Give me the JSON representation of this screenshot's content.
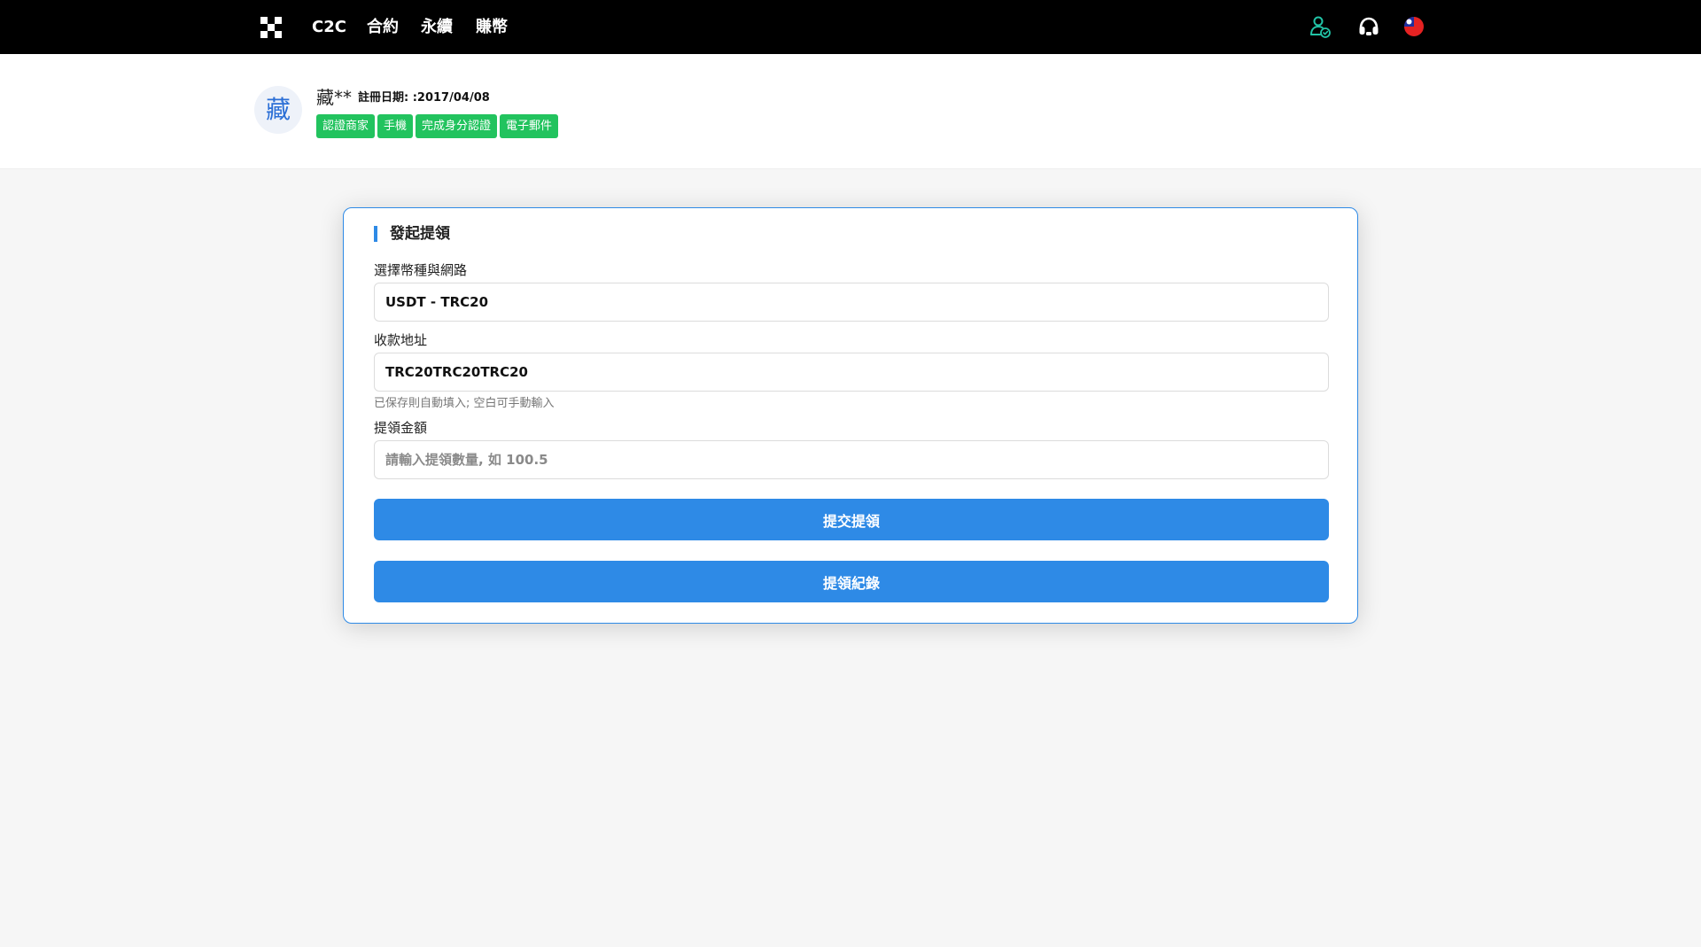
{
  "nav": {
    "items": [
      {
        "label": "C2C"
      },
      {
        "label": "合約"
      },
      {
        "label": "永續"
      },
      {
        "label": "賺幣"
      }
    ],
    "icons": [
      "user-shield-icon",
      "headset-icon",
      "flag-icon"
    ]
  },
  "profile": {
    "avatar_char": "藏",
    "name": "藏**",
    "registration": "註冊日期: :2017/04/08",
    "badges": [
      "認證商家",
      "手機",
      "完成身分認證",
      "電子郵件"
    ]
  },
  "withdraw": {
    "title": "發起提領",
    "coin_label": "選擇幣種與網路",
    "coin_value": "USDT - TRC20",
    "address_label": "收款地址",
    "address_value": "TRC20TRC20TRC20",
    "address_hint": "已保存則自動填入; 空白可手動輸入",
    "amount_label": "提領金額",
    "amount_placeholder": "請輸入提領數量, 如 100.5",
    "submit_label": "提交提領",
    "records_label": "提領紀錄"
  },
  "colors": {
    "accent": "#2e8ae6",
    "badge": "#22c35e",
    "topbar": "#000000"
  }
}
